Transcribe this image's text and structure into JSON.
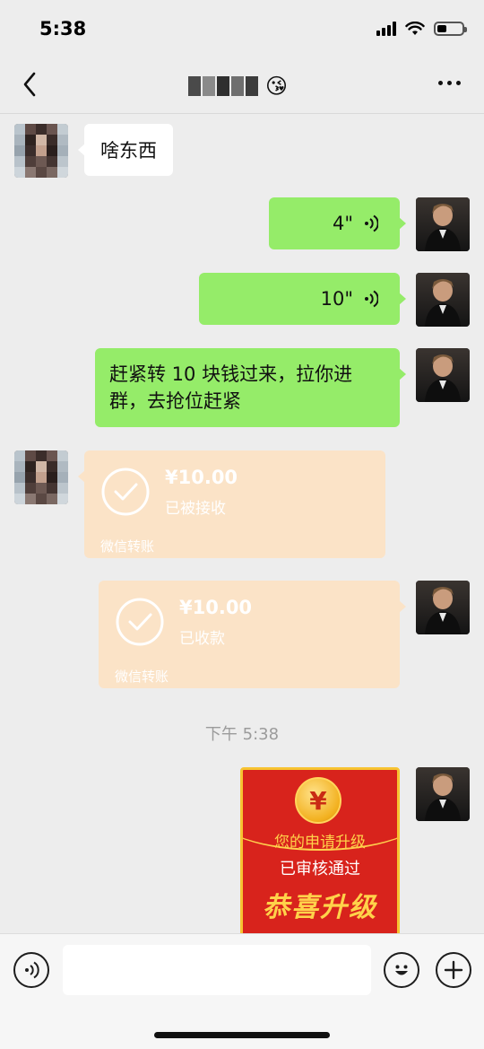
{
  "status_bar": {
    "time": "5:38"
  },
  "header": {
    "title_emoji": "😘"
  },
  "messages": {
    "m1_text": "啥东西",
    "m2_voice_duration": "4\"",
    "m3_voice_duration": "10\"",
    "m4_text_line1": "赶紧转 10 块钱过来，拉你进",
    "m4_text_line2": "群，去抢位赶紧",
    "m5_amount": "¥10.00",
    "m5_status": "已被接收",
    "m5_source": "微信转账",
    "m6_amount": "¥10.00",
    "m6_status": "已收款",
    "m6_source": "微信转账",
    "timestamp": "下午 5:38",
    "m7_coin": "¥",
    "m7_line1": "您的申请升级",
    "m7_line2": "已审核通过",
    "m7_line3": "恭喜升级"
  },
  "input_bar": {
    "placeholder": ""
  },
  "colors": {
    "background": "#ededed",
    "sent_bubble": "#95ec69",
    "received_bubble": "#ffffff",
    "transfer_bubble": "#fbe3c7",
    "upgrade_card": "#d8231c"
  },
  "icons": [
    "back-icon",
    "more-icon",
    "voice-wave-icon",
    "check-circle-icon",
    "voice-toggle-icon",
    "emoji-icon",
    "plus-icon"
  ]
}
